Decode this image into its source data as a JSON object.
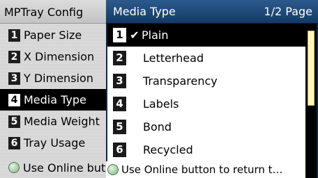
{
  "left_panel": {
    "title": "MPTray Config",
    "items": [
      {
        "num": "1",
        "label": "Paper Size"
      },
      {
        "num": "2",
        "label": "X Dimension"
      },
      {
        "num": "3",
        "label": "Y Dimension"
      },
      {
        "num": "4",
        "label": "Media Type",
        "selected": true
      },
      {
        "num": "5",
        "label": "Media Weight"
      },
      {
        "num": "6",
        "label": "Tray Usage"
      }
    ],
    "online_hint": "Use Online button to return"
  },
  "right_panel": {
    "title": "Media Type",
    "page": "1/2 Page",
    "items": [
      {
        "num": "1",
        "label": "Plain",
        "selected": true,
        "checked": true
      },
      {
        "num": "2",
        "label": "Letterhead"
      },
      {
        "num": "3",
        "label": "Transparency"
      },
      {
        "num": "4",
        "label": "Labels"
      },
      {
        "num": "5",
        "label": "Bond"
      },
      {
        "num": "6",
        "label": "Recycled"
      }
    ],
    "online_hint": "Use Online button to return t…",
    "check_glyph": "✔"
  },
  "colors": {
    "header_blue": "#1f4a7a",
    "scroll_thumb": "#fff6b8",
    "online_button": "#7fb37f"
  },
  "icons": {
    "check": "check-icon",
    "online_button": "online-button-icon"
  }
}
